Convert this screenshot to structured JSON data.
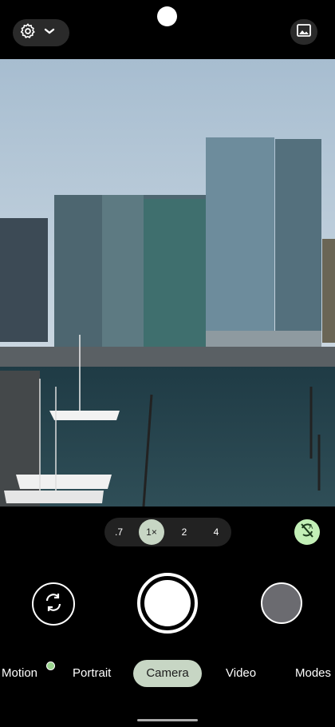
{
  "top": {
    "settings_icon": "gear-icon",
    "expand_icon": "chevron-down-icon",
    "gallery_icon": "image-icon"
  },
  "zoom": {
    "options": [
      ".7",
      "1×",
      "2",
      "4"
    ],
    "selected": "1×"
  },
  "controls": {
    "flash_icon": "flash-auto-off-icon",
    "switch_icon": "switch-camera-icon",
    "shutter_icon": "shutter-icon"
  },
  "modes": {
    "items": [
      "Motion",
      "Portrait",
      "Camera",
      "Video",
      "Modes"
    ],
    "selected": "Camera"
  },
  "colors": {
    "accent": "#c7d6c4",
    "flash": "#c2efb6",
    "motion_dot": "#9bd48f"
  }
}
